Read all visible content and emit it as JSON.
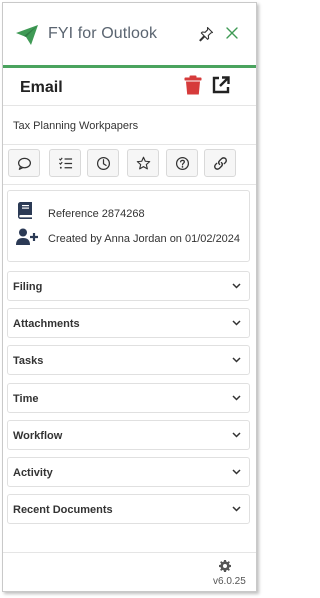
{
  "app": {
    "title": "FYI for Outlook",
    "accent_color": "#4aa35e"
  },
  "icons": {
    "logo": "paper-plane-icon",
    "pin": "pin-icon",
    "close": "close-icon",
    "trash": "trash-icon",
    "popout": "popout-icon",
    "toolbar": [
      "comment-icon",
      "task-list-icon",
      "clock-icon",
      "star-icon",
      "help-icon",
      "link-icon"
    ],
    "book": "book-icon",
    "user_add": "user-plus-icon",
    "gear": "gear-icon",
    "chevron": "chevron-down-icon"
  },
  "email": {
    "title": "Email",
    "subject": "Tax Planning Workpapers",
    "trash_color": "#d63b3b"
  },
  "info": {
    "reference": "Reference 2874268",
    "created": "Created by Anna Jordan on 01/02/2024"
  },
  "sections": [
    {
      "label": "Filing"
    },
    {
      "label": "Attachments"
    },
    {
      "label": "Tasks"
    },
    {
      "label": "Time"
    },
    {
      "label": "Workflow"
    },
    {
      "label": "Activity"
    },
    {
      "label": "Recent Documents"
    }
  ],
  "footer": {
    "version": "v6.0.25"
  }
}
